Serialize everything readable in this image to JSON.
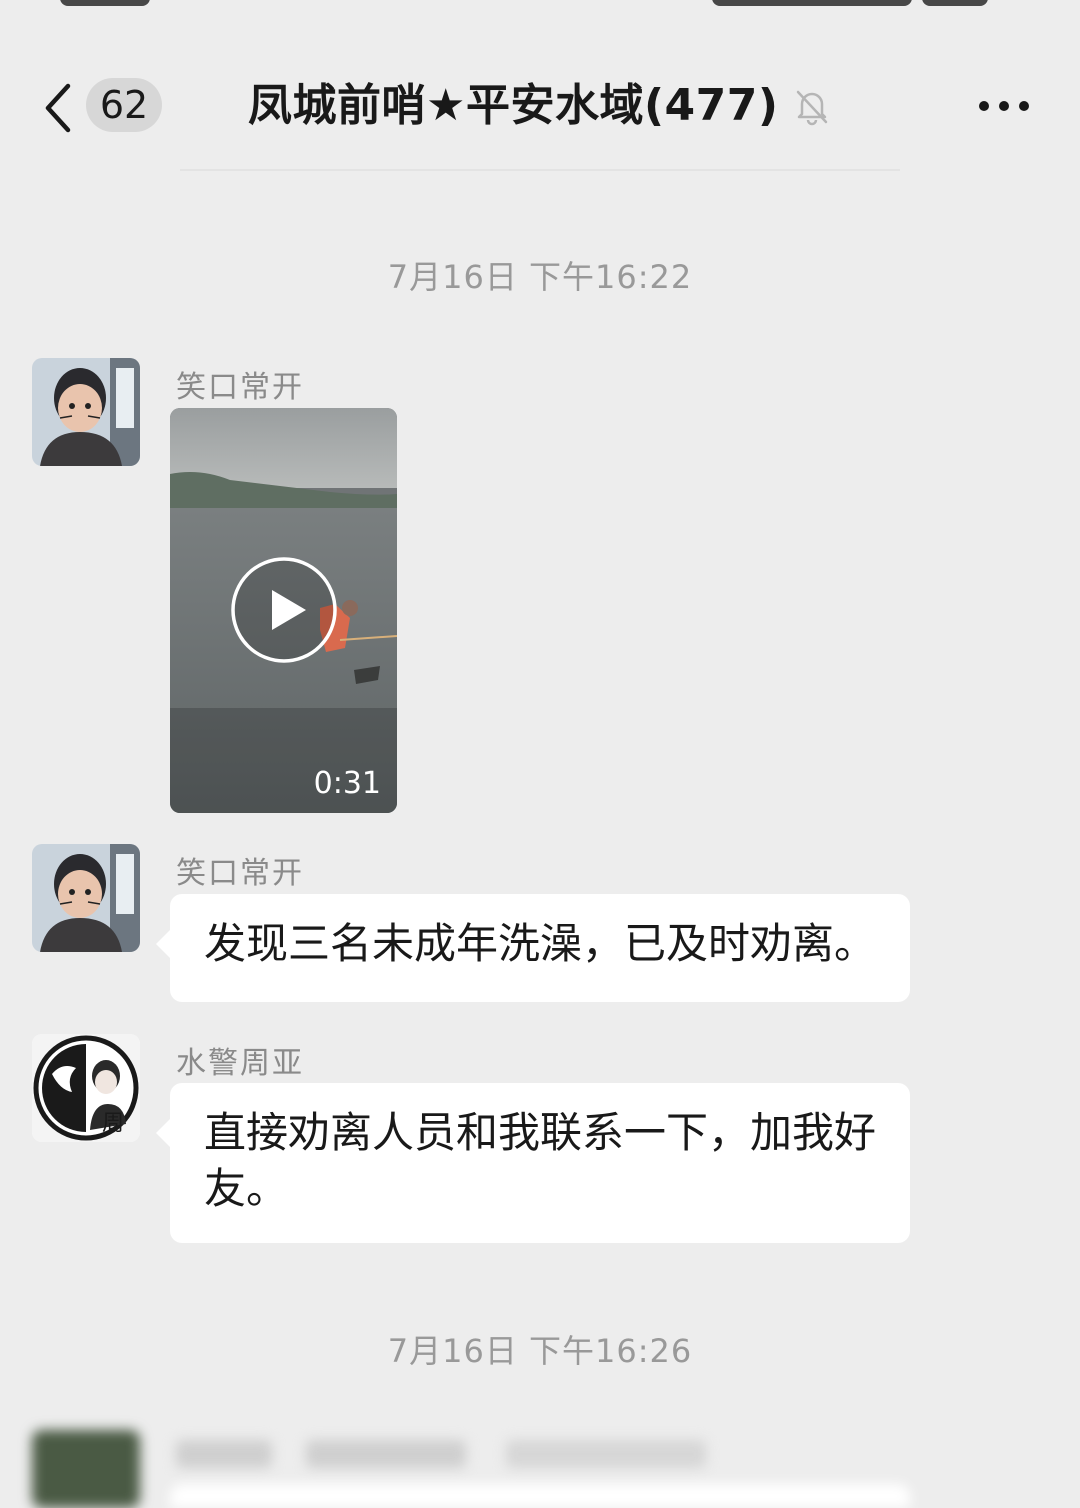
{
  "header": {
    "unread_count": "62",
    "title": "凤城前哨★平安水域(477)"
  },
  "messages": [
    {
      "timestamp": "7月16日 下午16:22"
    },
    {
      "sender": "笑口常开",
      "type": "video",
      "duration": "0:31"
    },
    {
      "sender": "笑口常开",
      "type": "text",
      "text": "发现三名未成年洗澡，已及时劝离。"
    },
    {
      "sender": "水警周亚",
      "type": "text",
      "text": "直接劝离人员和我联系一下，加我好友。"
    },
    {
      "timestamp": "7月16日 下午16:26"
    }
  ],
  "icons": {
    "back": "chevron-left-icon",
    "mute": "bell-off-icon",
    "more": "more-horizontal-icon",
    "play": "play-icon"
  },
  "colors": {
    "background": "#ededed",
    "bubble": "#ffffff",
    "timestamp": "#999999",
    "sender": "#8a8a8a"
  }
}
